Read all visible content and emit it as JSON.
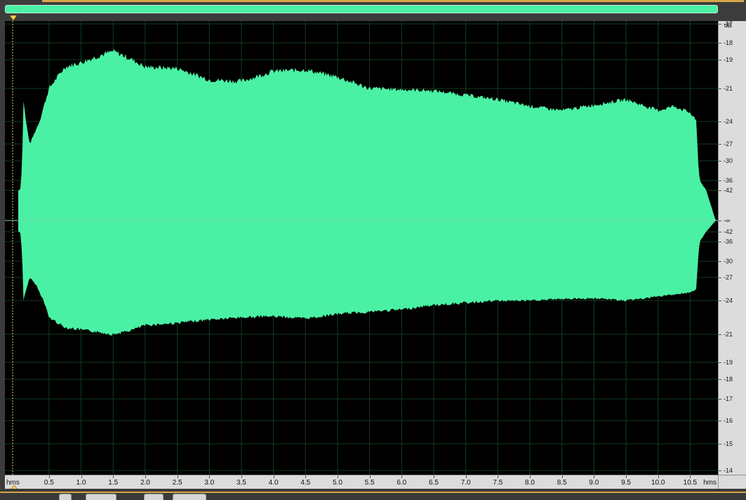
{
  "colors": {
    "waveform": "#4af1a4",
    "waveform_background": "#000000",
    "grid": "#123d1e",
    "center_line": "#7ad4a8",
    "ruler_background": "#dcdcdc",
    "accent_orange": "#d8a64a",
    "playhead": "#f2d34a"
  },
  "icons": {
    "overview_marker": "triangle-down-marker-icon",
    "time_marker": "triangle-up-marker-icon"
  },
  "db_ruler": {
    "unit": "dB",
    "top_labels": [
      "-17",
      "-18",
      "-19",
      "-21",
      "-24",
      "-27",
      "-30",
      "-36",
      "-42"
    ],
    "center_label": "-∞",
    "bottom_labels": [
      "-42",
      "-36",
      "-30",
      "-27",
      "-24",
      "-21",
      "-19",
      "-18",
      "-17",
      "-16",
      "-15",
      "-14"
    ]
  },
  "time_ruler": {
    "unit_left": "hms",
    "unit_right": "hms",
    "labels": [
      "0.5",
      "1.0",
      "1.5",
      "2.0",
      "2.5",
      "3.0",
      "3.5",
      "4.0",
      "4.5",
      "5.0",
      "5.5",
      "6.0",
      "6.5",
      "7.0",
      "7.5",
      "8.0",
      "8.5",
      "9.0",
      "9.5",
      "10.0",
      "10.5"
    ]
  },
  "waveform": {
    "duration_seconds": 10.9,
    "envelope_db_time": [
      0.05,
      0.1,
      0.2,
      0.3,
      0.5,
      0.75,
      1.0,
      1.25,
      1.5,
      1.75,
      2.0,
      2.5,
      3.0,
      3.5,
      4.0,
      4.5,
      5.0,
      5.5,
      6.0,
      6.5,
      7.0,
      7.5,
      8.0,
      8.5,
      9.0,
      9.5,
      10.0,
      10.25,
      10.5,
      10.6,
      10.65,
      10.75,
      10.9
    ],
    "envelope_db_upper": [
      -42,
      -22,
      -27,
      -25,
      -21,
      -19.5,
      -19.2,
      -18.8,
      -18.5,
      -18.9,
      -19.5,
      -19.6,
      -20.4,
      -20.5,
      -19.8,
      -19.7,
      -20.2,
      -21.0,
      -21.1,
      -21.2,
      -21.6,
      -22.0,
      -22.6,
      -23.0,
      -22.5,
      -22.0,
      -23.0,
      -22.6,
      -23.2,
      -24.0,
      -36,
      -42,
      -60
    ],
    "envelope_db_lower": [
      -42,
      -24,
      -27,
      -26,
      -22.5,
      -21.6,
      -21.4,
      -21.2,
      -21.0,
      -21.3,
      -21.8,
      -22.0,
      -22.3,
      -22.5,
      -22.6,
      -22.4,
      -22.8,
      -23.0,
      -23.2,
      -23.6,
      -23.8,
      -24.0,
      -24.0,
      -24.2,
      -24.3,
      -24.0,
      -24.5,
      -24.8,
      -25.0,
      -25.5,
      -36,
      -42,
      -60
    ]
  }
}
